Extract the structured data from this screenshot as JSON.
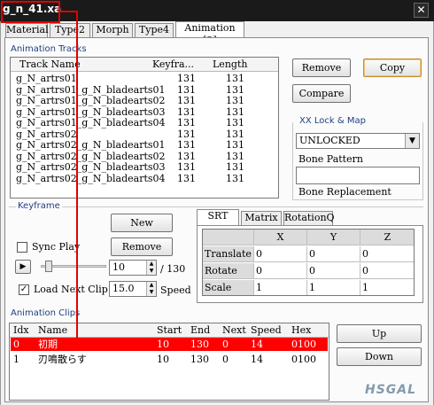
{
  "window": {
    "title": "g_n_41.xa",
    "close_glyph": "✕"
  },
  "tabs": [
    "Material",
    "Type2",
    "Morph",
    "Type4",
    "Animation [2]"
  ],
  "tracks": {
    "group_label": "Animation Tracks",
    "columns": [
      "Track Name",
      "Keyfra...",
      "Length"
    ],
    "rows": [
      [
        "g_N_artrs01",
        "131",
        "131"
      ],
      [
        "g_N_artrs01_g_N_bladearts01",
        "131",
        "131"
      ],
      [
        "g_N_artrs01_g_N_bladearts02",
        "131",
        "131"
      ],
      [
        "g_N_artrs01_g_N_bladearts03",
        "131",
        "131"
      ],
      [
        "g_N_artrs01_g_N_bladearts04",
        "131",
        "131"
      ],
      [
        "g_N_artrs02",
        "131",
        "131"
      ],
      [
        "g_N_artrs02_g_N_bladearts01",
        "131",
        "131"
      ],
      [
        "g_N_artrs02_g_N_bladearts02",
        "131",
        "131"
      ],
      [
        "g_N_artrs02_g_N_bladearts03",
        "131",
        "131"
      ],
      [
        "g_N_artrs02_g_N_bladearts04",
        "131",
        "131"
      ]
    ]
  },
  "track_buttons": {
    "remove": "Remove",
    "copy": "Copy",
    "compare": "Compare"
  },
  "lockmap": {
    "group_label": "XX Lock & Map",
    "mode_value": "UNLOCKED",
    "bone_pattern_label": "Bone Pattern",
    "bone_pattern_value": "",
    "bone_replacement_label": "Bone Replacement"
  },
  "keyframe": {
    "group_label": "Keyframe",
    "new_label": "New",
    "remove_label": "Remove",
    "sync_play_label": "Sync Play",
    "sync_play_checked": false,
    "play_glyph": "▶",
    "frame_value": "10",
    "frame_total": "/ 130",
    "frame_fraction": 0.077,
    "load_next_clip_label": "Load Next Clip",
    "load_next_clip_checked": true,
    "check_glyph": "✓",
    "speed_value": "15.0",
    "speed_label": "Speed"
  },
  "srt": {
    "tabs": [
      "SRT",
      "Matrix",
      "RotationQ"
    ],
    "columns": [
      "",
      "X",
      "Y",
      "Z"
    ],
    "rows": [
      [
        "Translate",
        "0",
        "0",
        "0"
      ],
      [
        "Rotate",
        "0",
        "0",
        "0"
      ],
      [
        "Scale",
        "1",
        "1",
        "1"
      ]
    ]
  },
  "clips": {
    "group_label": "Animation Clips",
    "columns": [
      "Idx",
      "Name",
      "Start",
      "End",
      "Next",
      "Speed",
      "Hex"
    ],
    "rows": [
      [
        "0",
        "初期",
        "10",
        "130",
        "0",
        "14",
        "0100"
      ],
      [
        "1",
        "刃鳴散らす",
        "10",
        "130",
        "0",
        "14",
        "0100"
      ]
    ],
    "selected_row": 0
  },
  "clip_buttons": {
    "up": "Up",
    "down": "Down"
  },
  "watermark": {
    "text": "HSGAL"
  },
  "colors": {
    "selection": "#ff0000",
    "highlight_box": "#e00000",
    "titlebar": "#1a1a1a"
  }
}
